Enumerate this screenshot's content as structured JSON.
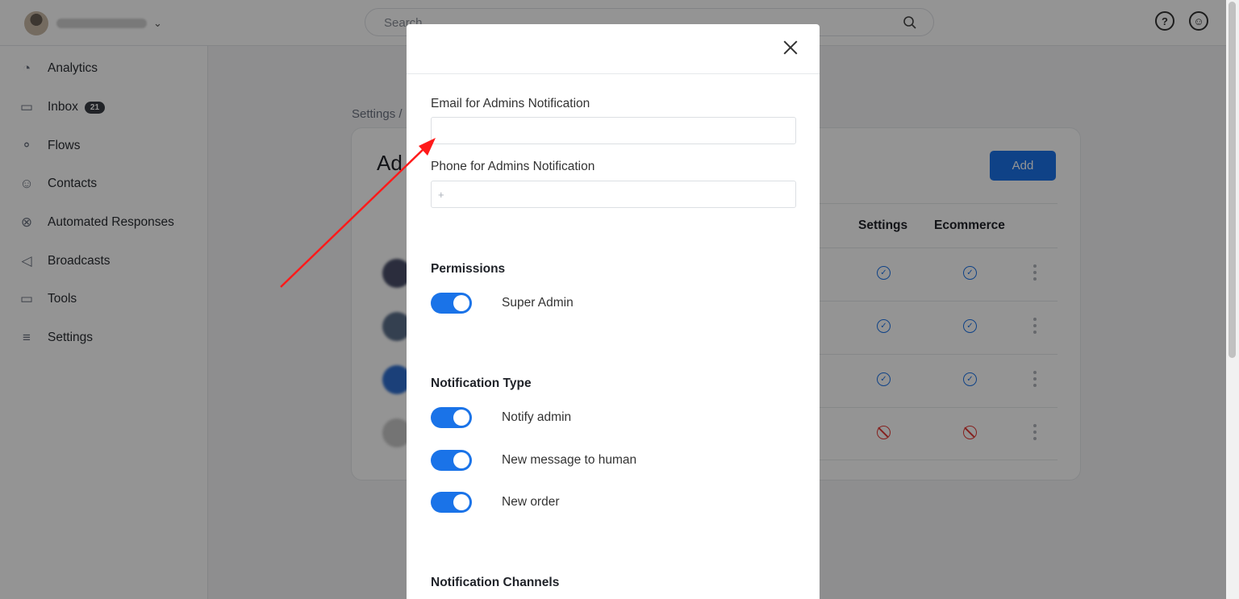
{
  "topbar": {
    "search_placeholder": "Search",
    "search_icon": "search-icon",
    "help_icon": "help-icon",
    "account_icon": "user-circle-icon",
    "help_glyph": "?",
    "account_glyph": "☺",
    "account_chevron": "⌄"
  },
  "sidebar": {
    "items": [
      {
        "label": "Analytics",
        "icon": "pie-chart-icon",
        "glyph": "◔"
      },
      {
        "label": "Inbox",
        "icon": "chat-bubbles-icon",
        "glyph": "▭",
        "badge": "21"
      },
      {
        "label": "Flows",
        "icon": "flow-icon",
        "glyph": "⚬"
      },
      {
        "label": "Contacts",
        "icon": "contacts-icon",
        "glyph": "☺"
      },
      {
        "label": "Automated Responses",
        "icon": "atom-icon",
        "glyph": "⊗"
      },
      {
        "label": "Broadcasts",
        "icon": "megaphone-icon",
        "glyph": "◁"
      },
      {
        "label": "Tools",
        "icon": "toolbox-icon",
        "glyph": "▭"
      },
      {
        "label": "Settings",
        "icon": "sliders-icon",
        "glyph": "≡"
      }
    ]
  },
  "background": {
    "breadcrumb": "Settings /",
    "card_title": "Ad",
    "add_button": "Add",
    "columns": [
      "Settings",
      "Ecommerce"
    ],
    "rows": [
      {
        "settings": "check",
        "ecommerce": "check"
      },
      {
        "settings": "check",
        "ecommerce": "check"
      },
      {
        "settings": "check",
        "ecommerce": "check"
      },
      {
        "settings": "blocked",
        "ecommerce": "blocked"
      }
    ]
  },
  "modal": {
    "email_label": "Email for Admins Notification",
    "email_value": "",
    "phone_label": "Phone for Admins Notification",
    "phone_placeholder": "+",
    "permissions_heading": "Permissions",
    "permissions": [
      {
        "label": "Super Admin",
        "on": true
      }
    ],
    "notification_type_heading": "Notification Type",
    "notification_types": [
      {
        "label": "Notify admin",
        "on": true
      },
      {
        "label": "New message to human",
        "on": true
      },
      {
        "label": "New order",
        "on": true
      }
    ],
    "notification_channels_heading": "Notification Channels"
  },
  "colors": {
    "accent": "#1a73e8",
    "annotation_arrow": "#ff1a1a",
    "blocked": "#e53935"
  }
}
